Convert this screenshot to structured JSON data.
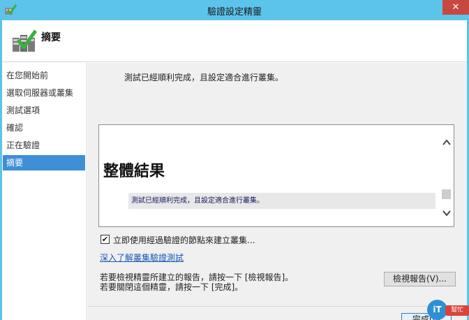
{
  "window": {
    "title": "驗證設定精靈",
    "close_glyph": "✕",
    "icon": "wizard-app-icon"
  },
  "header": {
    "title": "摘要",
    "icon": "cluster-validation-icon"
  },
  "sidebar": {
    "items": [
      {
        "label": "在您開始前",
        "active": false
      },
      {
        "label": "選取伺服器或叢集",
        "active": false
      },
      {
        "label": "測試選項",
        "active": false
      },
      {
        "label": "確認",
        "active": false
      },
      {
        "label": "正在驗證",
        "active": false
      },
      {
        "label": "摘要",
        "active": true
      }
    ]
  },
  "main": {
    "status_text": "測試已經順利完成，且設定適合進行叢集。",
    "report": {
      "heading": "整體結果",
      "result_line": "測試已經順利完成，且設定適合進行叢集。"
    },
    "create_cluster_checkbox": {
      "label": "立即使用經過驗證的節點來建立叢集...",
      "checked": true
    },
    "learn_link": "深入了解叢集驗證測試",
    "info_line_1": "若要檢視精靈所建立的報告，請按一下 [檢視報告]。",
    "info_line_2": "若要關閉這個精靈，請按一下 [完成]。",
    "view_report_button": "檢視報告(V)...",
    "finish_button": "完成(F)"
  },
  "watermark": {
    "circle_text": "iT",
    "tag_text": "幫忙"
  },
  "colors": {
    "titlebar": "#5cc4eb",
    "close_button": "#c7483f",
    "active_nav": "#3e8fd8",
    "link": "#1a57b8"
  }
}
